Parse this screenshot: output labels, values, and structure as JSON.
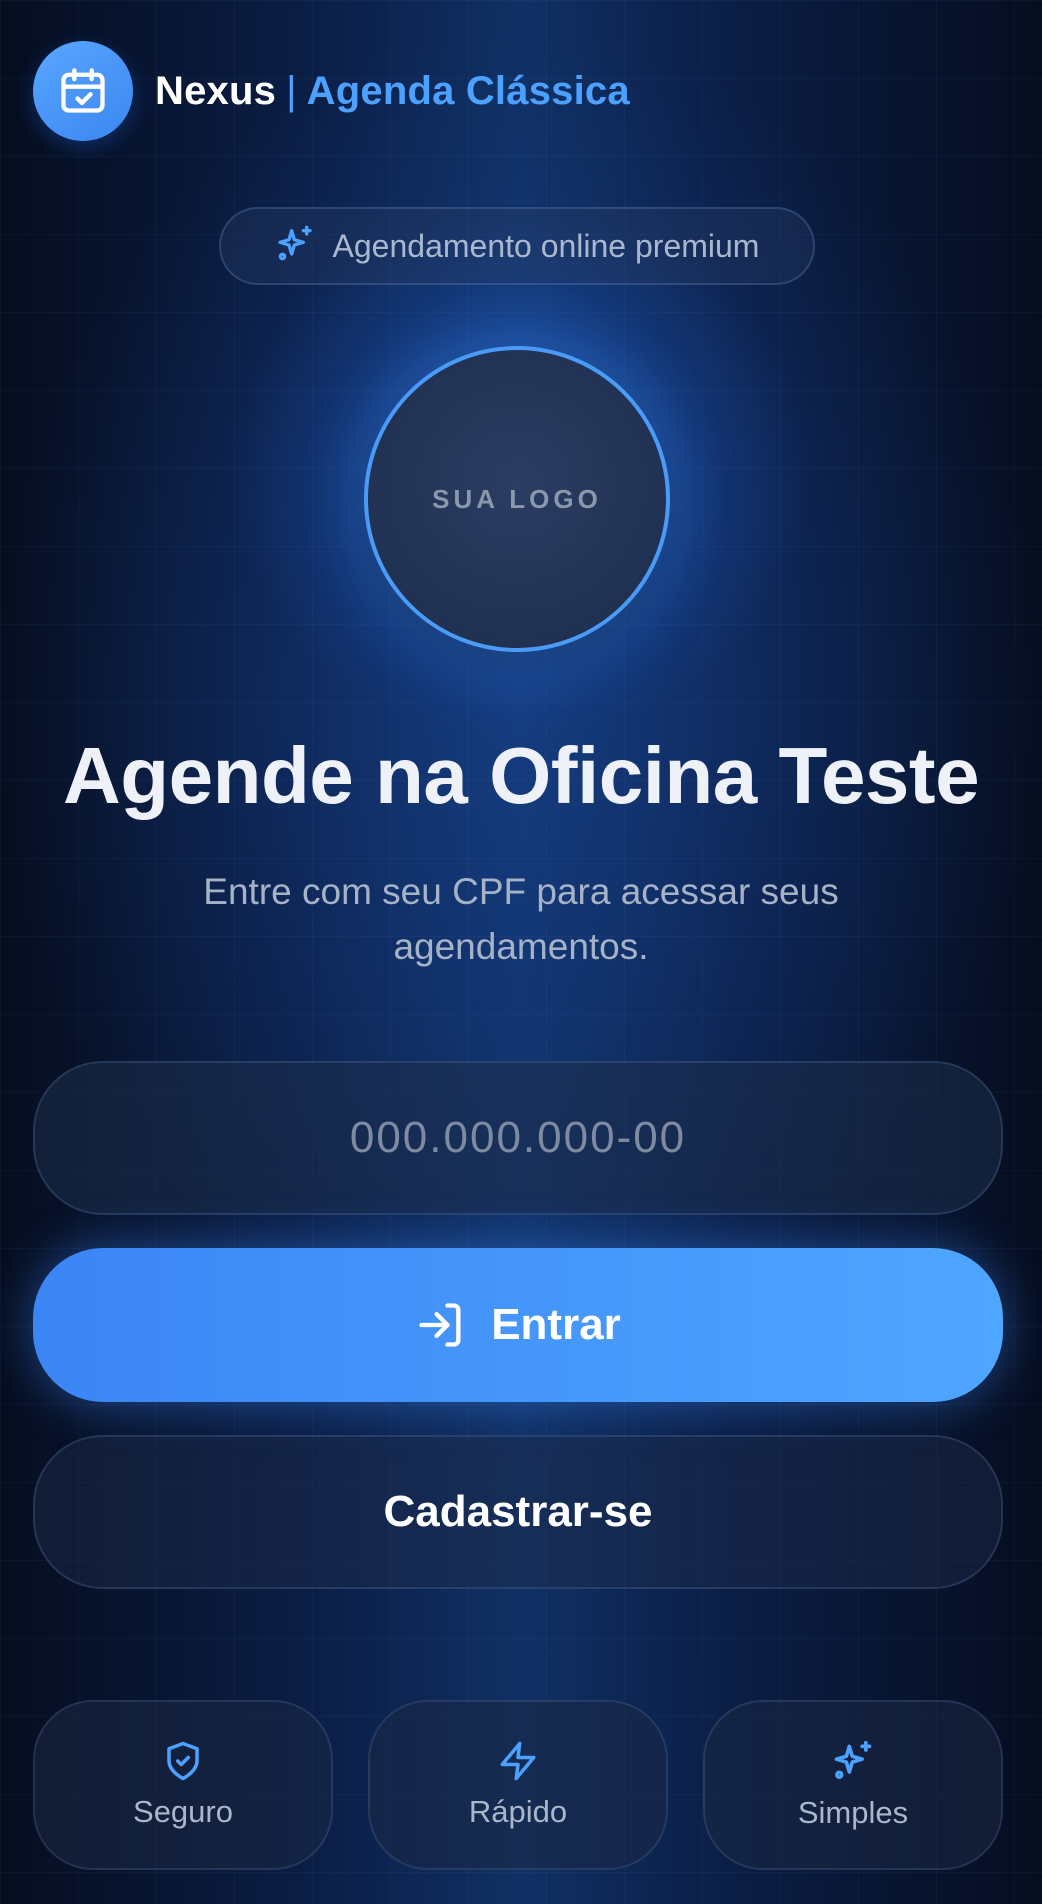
{
  "header": {
    "app_icon": "calendar-check-icon",
    "brand_name": "Nexus",
    "separator": "|",
    "product_name": "Agenda Clássica"
  },
  "badge": {
    "icon": "sparkles-icon",
    "text": "Agendamento online premium"
  },
  "logo": {
    "text": "SUA LOGO"
  },
  "hero": {
    "title": "Agende na Oficina Teste",
    "subtitle": "Entre com seu CPF para acessar seus agendamentos."
  },
  "form": {
    "cpf_placeholder": "000.000.000-00",
    "cpf_value": "",
    "login_icon": "log-in-icon",
    "login_label": "Entrar",
    "register_label": "Cadastrar-se"
  },
  "features": [
    {
      "icon": "shield-check-icon",
      "label": "Seguro"
    },
    {
      "icon": "zap-icon",
      "label": "Rápido"
    },
    {
      "icon": "sparkles-icon",
      "label": "Simples"
    }
  ],
  "colors": {
    "accent": "#4ca1ff",
    "primary_button_start": "#3b85f5",
    "primary_button_end": "#4fa6ff",
    "background_dark": "#060d1f"
  }
}
